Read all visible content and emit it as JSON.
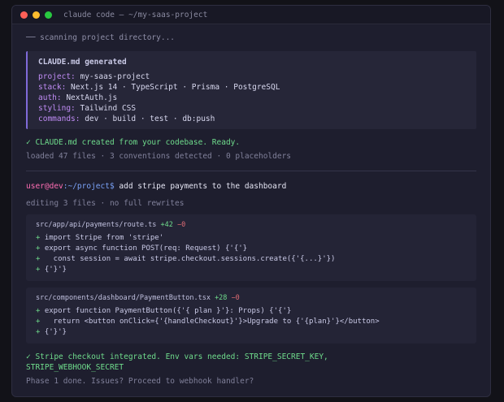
{
  "window": {
    "title": "claude code — ~/my-saas-project"
  },
  "scan": "── scanning project directory...",
  "claudemd": {
    "heading": "CLAUDE.md generated",
    "rows": [
      {
        "k": "project:",
        "v": " my-saas-project"
      },
      {
        "k": "stack:",
        "v": " Next.js 14 · TypeScript · Prisma · PostgreSQL"
      },
      {
        "k": "auth:",
        "v": " NextAuth.js"
      },
      {
        "k": "styling:",
        "v": " Tailwind CSS"
      },
      {
        "k": "commands:",
        "v": " dev · build · test · db:push"
      }
    ]
  },
  "created": "✓ CLAUDE.md created from your codebase. Ready.",
  "loaded": "loaded 47 files · 3 conventions detected · 0 placeholders",
  "prompt": {
    "user": "user@dev",
    "path": ":~/project$",
    "command": " add stripe payments to the dashboard"
  },
  "editing": "editing 3 files · no full rewrites",
  "diffs": [
    {
      "file": "src/app/api/payments/route.ts",
      "added": "+42",
      "removed": "−0",
      "lines": [
        "import Stripe from 'stripe'",
        "export async function POST(req: Request) {'{'}",
        "  const session = await stripe.checkout.sessions.create({'{...}'})",
        "{'}'}"
      ]
    },
    {
      "file": "src/components/dashboard/PaymentButton.tsx",
      "added": "+28",
      "removed": "−0",
      "lines": [
        "export function PaymentButton({'{ plan }'}: Props) {'{'}",
        "  return <button onClick={'{handleCheckout}'}>Upgrade to {'{plan}'}</button>",
        "{'}'}"
      ]
    }
  ],
  "result": {
    "line1": "✓ Stripe checkout integrated. Env vars needed: STRIPE_SECRET_KEY,",
    "line2": "STRIPE_WEBHOOK_SECRET"
  },
  "phase": "Phase 1 done. Issues? Proceed to webhook handler?",
  "colors": {
    "accent": "#7f6ad8",
    "success": "#6fdc8c",
    "key": "#c08cf5",
    "user": "#ff6eb4",
    "host": "#7aa2f7"
  }
}
